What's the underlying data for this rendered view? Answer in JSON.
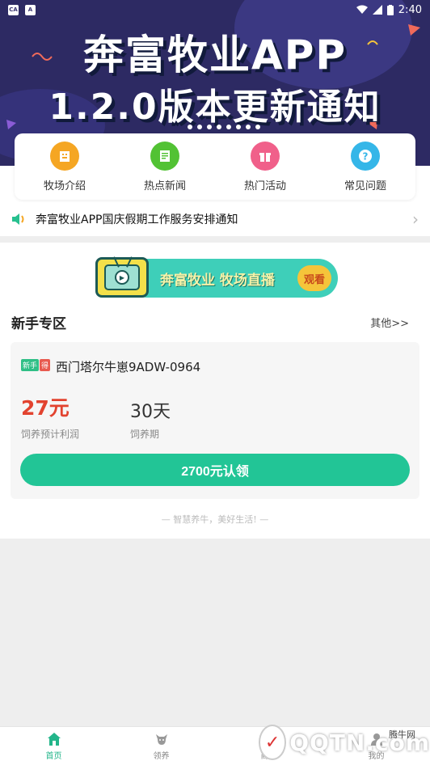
{
  "status_bar": {
    "badge1": "CA",
    "badge2": "A",
    "time": "2:40"
  },
  "banner": {
    "title_line1": "奔富牧业APP",
    "title_line2": "1.2.0版本更新通知"
  },
  "quick_menu": [
    {
      "label": "牧场介绍",
      "icon": "building-icon",
      "color": "#f5a623"
    },
    {
      "label": "热点新闻",
      "icon": "news-icon",
      "color": "#52c234"
    },
    {
      "label": "热门活动",
      "icon": "gift-icon",
      "color": "#f0608a"
    },
    {
      "label": "常见问题",
      "icon": "question-icon",
      "color": "#35b6e8"
    }
  ],
  "notice": {
    "text": "奔富牧业APP国庆假期工作服务安排通知"
  },
  "live": {
    "text": "奔富牧业 牧场直播",
    "button": "观看"
  },
  "newbie": {
    "title": "新手专区",
    "more": "其他>>",
    "product": {
      "tag1": "新手",
      "tag2": "得",
      "name": "西门塔尔牛崽9ADW-0964",
      "profit": "27元",
      "profit_label": "饲养预计利润",
      "period": "30天",
      "period_label": "饲养期",
      "button": "2700元认领"
    }
  },
  "slogan": "— 智慧养牛，美好生活! —",
  "tabbar": [
    {
      "label": "首页",
      "active": true
    },
    {
      "label": "领养",
      "active": false
    },
    {
      "label": "商城",
      "active": false
    },
    {
      "label": "我的",
      "active": false
    }
  ],
  "watermark": {
    "text": "QQTN.com",
    "small": "腾牛网"
  },
  "colors": {
    "accent": "#22c596",
    "banner_bg": "#2d2a63",
    "price_red": "#e2432f"
  }
}
